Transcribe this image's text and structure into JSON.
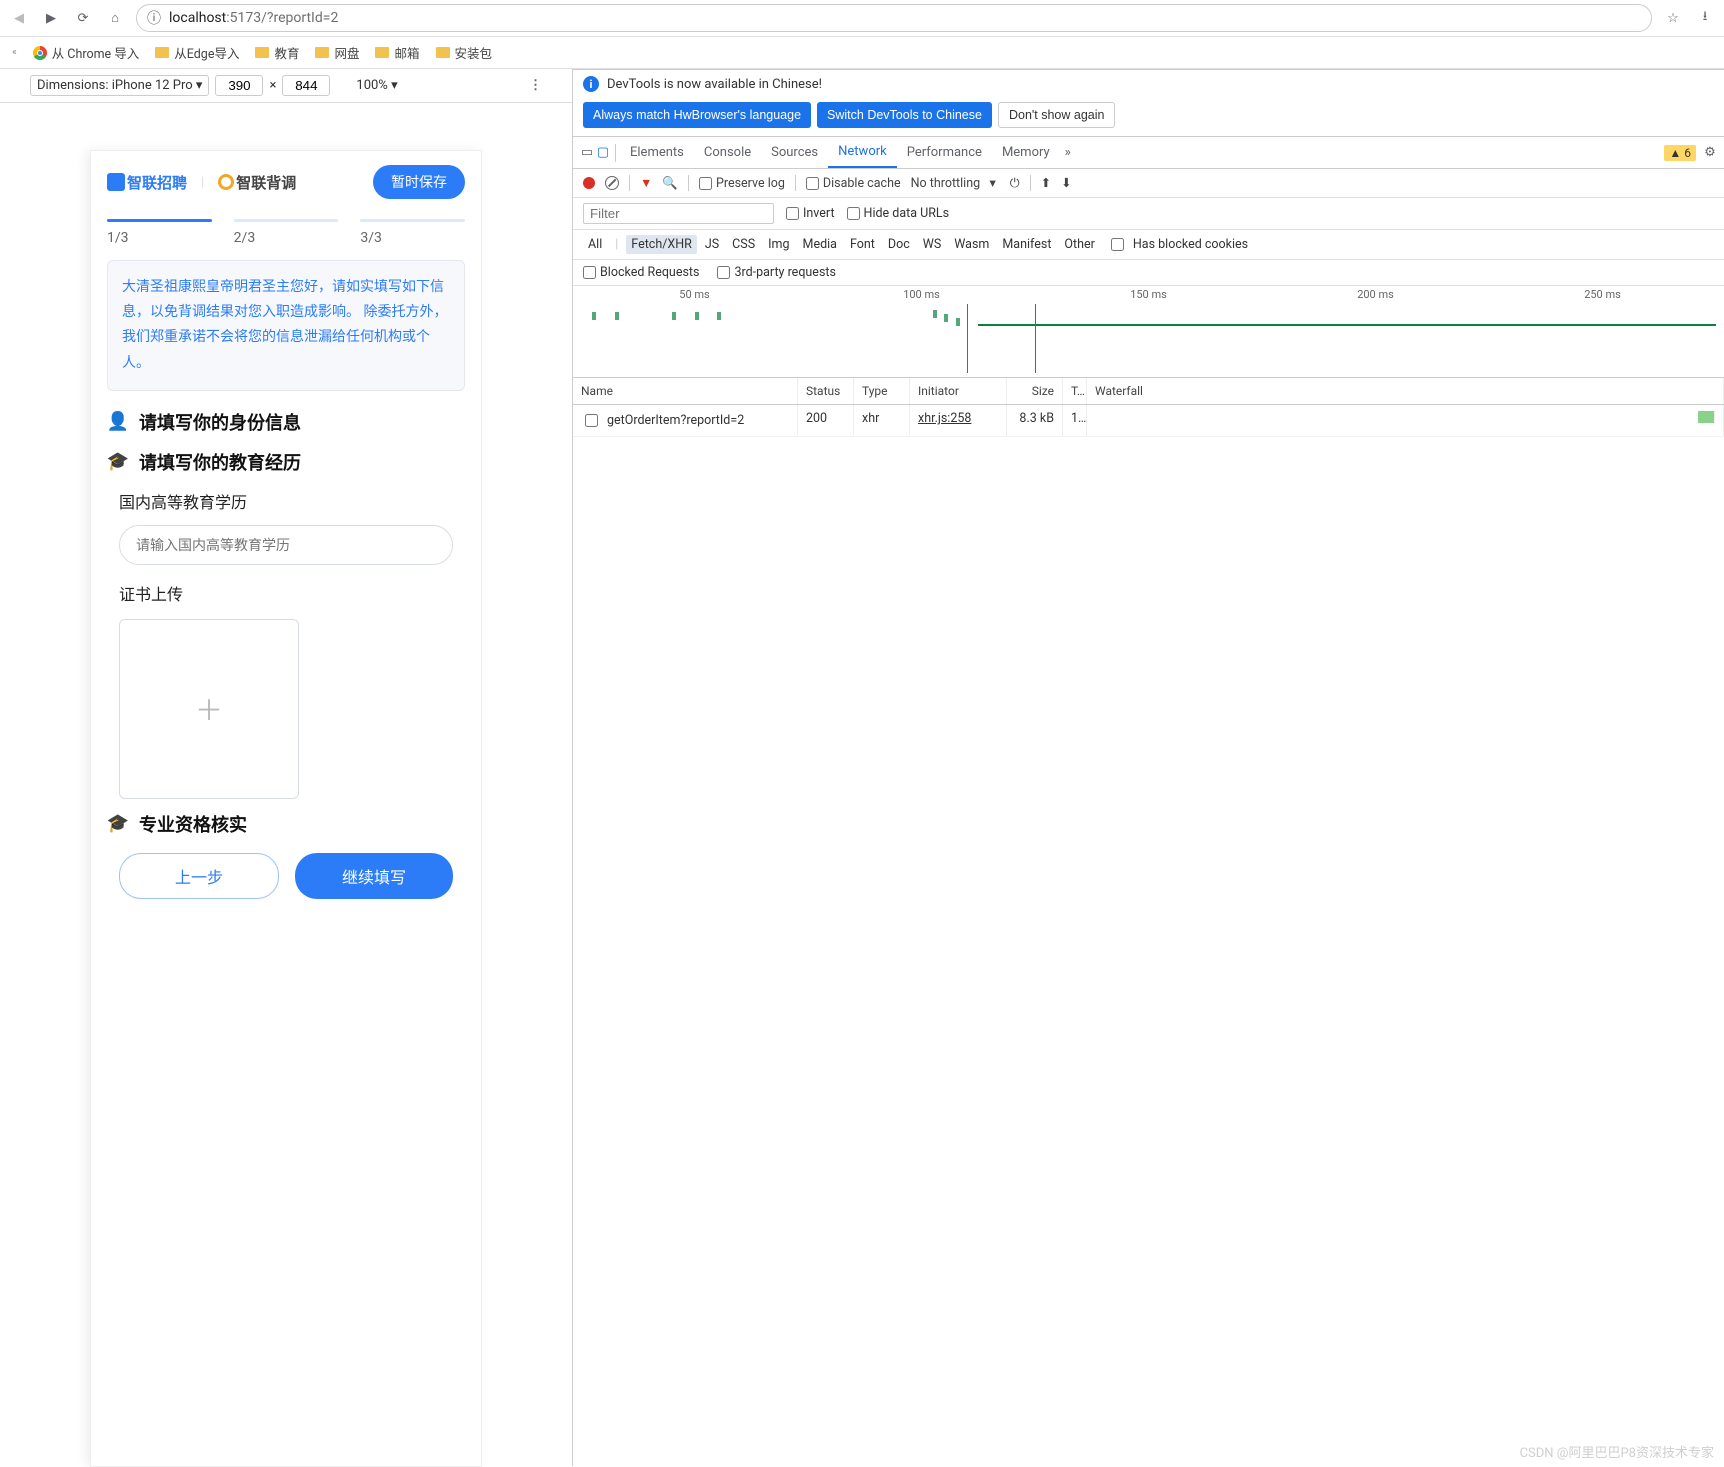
{
  "browser": {
    "url_host": "localhost",
    "url_port_path": ":5173/?reportId=2",
    "bookmarks": [
      "从 Chrome 导入",
      "从Edge导入",
      "教育",
      "网盘",
      "邮箱",
      "安装包"
    ]
  },
  "device_bar": {
    "label": "Dimensions: iPhone 12 Pro",
    "width": "390",
    "height": "844",
    "zoom": "100%"
  },
  "mobile": {
    "brand1": "智联招聘",
    "brand2": "智联背调",
    "save": "暂时保存",
    "steps": [
      "1/3",
      "2/3",
      "3/3"
    ],
    "notice": "大清圣祖康熙皇帝明君圣主您好，请如实填写如下信息，以免背调结果对您入职造成影响。 除委托方外，我们郑重承诺不会将您的信息泄漏给任何机构或个人。",
    "section_identity": "请填写你的身份信息",
    "section_edu": "请填写你的教育经历",
    "field_edu_label": "国内高等教育学历",
    "field_edu_placeholder": "请输入国内高等教育学历",
    "upload_label": "证书上传",
    "section_qual": "专业资格核实",
    "btn_prev": "上一步",
    "btn_next": "继续填写"
  },
  "devtools": {
    "alert": "DevTools is now available in Chinese!",
    "btn_match": "Always match HwBrowser's language",
    "btn_switch": "Switch DevTools to Chinese",
    "btn_dont": "Don't show again",
    "tabs": [
      "Elements",
      "Console",
      "Sources",
      "Network",
      "Performance",
      "Memory"
    ],
    "warn_count": "6",
    "toolbar": {
      "preserve": "Preserve log",
      "disable_cache": "Disable cache",
      "throttling": "No throttling"
    },
    "filter_placeholder": "Filter",
    "filter_invert": "Invert",
    "filter_hide": "Hide data URLs",
    "types": [
      "All",
      "Fetch/XHR",
      "JS",
      "CSS",
      "Img",
      "Media",
      "Font",
      "Doc",
      "WS",
      "Wasm",
      "Manifest",
      "Other"
    ],
    "blocked_cookies": "Has blocked cookies",
    "blocked_req": "Blocked Requests",
    "third_party": "3rd-party requests",
    "timeline_labels": [
      "50 ms",
      "100 ms",
      "150 ms",
      "200 ms",
      "250 ms"
    ],
    "table_head": [
      "Name",
      "Status",
      "Type",
      "Initiator",
      "Size",
      "T...",
      "Waterfall"
    ],
    "rows": [
      {
        "name": "getOrderItem?reportId=2",
        "status": "200",
        "type": "xhr",
        "initiator": "xhr.js:258",
        "size": "8.3 kB",
        "time": "1..."
      }
    ]
  },
  "watermark": "CSDN @阿里巴巴P8资深技术专家"
}
